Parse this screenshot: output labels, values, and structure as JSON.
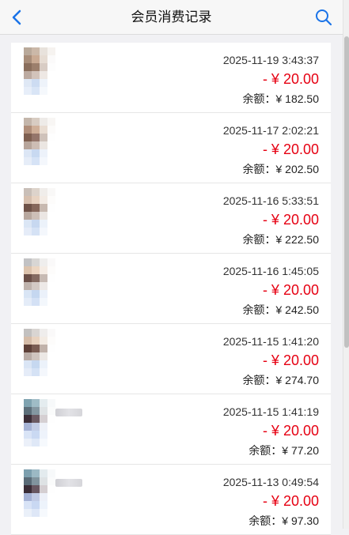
{
  "header": {
    "title": "会员消费记录",
    "back_icon": "chevron-left-icon",
    "search_icon": "search-icon",
    "accent_color": "#1a73e8"
  },
  "records": [
    {
      "datetime": "2025-11-19 3:43:37",
      "amount": "- ¥ 20.00",
      "balance": "余额：¥ 182.50"
    },
    {
      "datetime": "2025-11-17 2:02:21",
      "amount": "- ¥ 20.00",
      "balance": "余额：¥ 202.50"
    },
    {
      "datetime": "2025-11-16 5:33:51",
      "amount": "- ¥ 20.00",
      "balance": "余额：¥ 222.50"
    },
    {
      "datetime": "2025-11-16 1:45:05",
      "amount": "- ¥ 20.00",
      "balance": "余额：¥ 242.50"
    },
    {
      "datetime": "2025-11-15 1:41:20",
      "amount": "- ¥ 20.00",
      "balance": "余额：¥ 274.70"
    },
    {
      "datetime": "2025-11-15 1:41:19",
      "amount": "- ¥ 20.00",
      "balance": "余额：¥ 77.20"
    },
    {
      "datetime": "2025-11-13 0:49:54",
      "amount": "- ¥ 20.00",
      "balance": "余额：¥ 97.30"
    }
  ],
  "colors": {
    "amount": "#e60012",
    "header_bg": "#f7f7f7",
    "page_bg": "#f1f1f4"
  }
}
